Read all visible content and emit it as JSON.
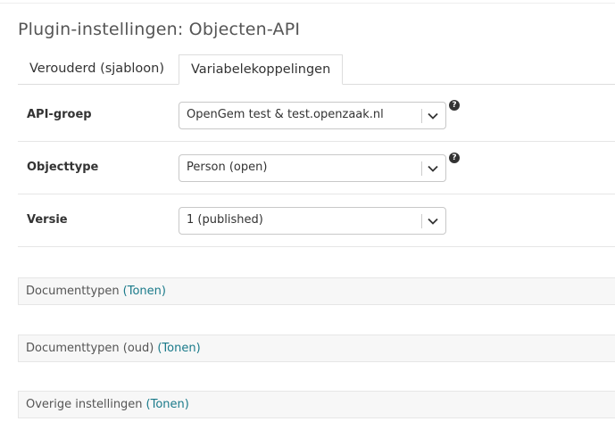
{
  "page": {
    "title": "Plugin-instellingen: Objecten-API"
  },
  "tabs": [
    {
      "label": "Verouderd (sjabloon)",
      "active": false
    },
    {
      "label": "Variabelekoppelingen",
      "active": true
    }
  ],
  "fields": [
    {
      "label": "API-groep",
      "value": "OpenGem test & test.openzaak.nl",
      "has_help": true
    },
    {
      "label": "Objecttype",
      "value": "Person (open)",
      "has_help": true
    },
    {
      "label": "Versie",
      "value": "1 (published)",
      "has_help": false
    }
  ],
  "help_icon_glyph": "?",
  "fieldsets": [
    {
      "label": "Documenttypen",
      "toggle": "(Tonen)"
    },
    {
      "label": "Documenttypen (oud)",
      "toggle": "(Tonen)"
    },
    {
      "label": "Overige instellingen",
      "toggle": "(Tonen)"
    }
  ],
  "colors": {
    "link": "#1a7a8a",
    "fieldset_bg": "#f7f7f7"
  }
}
